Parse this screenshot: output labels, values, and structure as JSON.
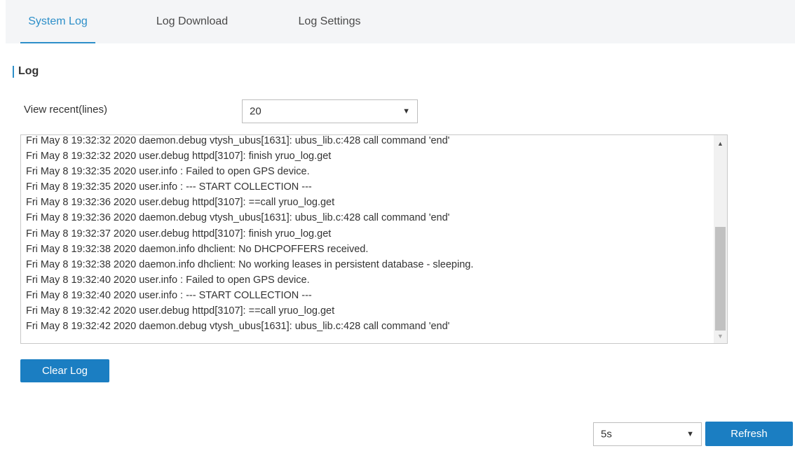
{
  "tabs": [
    {
      "label": "System Log",
      "active": true
    },
    {
      "label": "Log Download",
      "active": false
    },
    {
      "label": "Log Settings",
      "active": false
    }
  ],
  "section": {
    "title": "Log"
  },
  "view_recent": {
    "label": "View recent(lines)",
    "value": "20"
  },
  "log": {
    "lines": [
      "Fri May 8 19:32:32 2020 daemon.debug vtysh_ubus[1631]: ubus_lib.c:428 call command 'end'",
      "Fri May 8 19:32:32 2020 user.debug httpd[3107]: finish yruo_log.get",
      "Fri May 8 19:32:35 2020 user.info : Failed to open GPS device.",
      "Fri May 8 19:32:35 2020 user.info : --- START COLLECTION ---",
      "Fri May 8 19:32:36 2020 user.debug httpd[3107]: ==call yruo_log.get",
      "Fri May 8 19:32:36 2020 daemon.debug vtysh_ubus[1631]: ubus_lib.c:428 call command 'end'",
      "Fri May 8 19:32:37 2020 user.debug httpd[3107]: finish yruo_log.get",
      "Fri May 8 19:32:38 2020 daemon.info dhclient: No DHCPOFFERS received.",
      "Fri May 8 19:32:38 2020 daemon.info dhclient: No working leases in persistent database - sleeping.",
      "Fri May 8 19:32:40 2020 user.info : Failed to open GPS device.",
      "Fri May 8 19:32:40 2020 user.info : --- START COLLECTION ---",
      "Fri May 8 19:32:42 2020 user.debug httpd[3107]: ==call yruo_log.get",
      "Fri May 8 19:32:42 2020 daemon.debug vtysh_ubus[1631]: ubus_lib.c:428 call command 'end'"
    ]
  },
  "buttons": {
    "clear_log": "Clear Log",
    "refresh": "Refresh"
  },
  "refresh_interval": {
    "value": "5s"
  },
  "icons": {
    "dropdown": "chevron-down-icon",
    "scroll_up": "scroll-up-arrow-icon",
    "scroll_down": "scroll-down-arrow-icon"
  },
  "colors": {
    "accent": "#2d8fc9",
    "button": "#1b7ec2",
    "tabbar_bg": "#f4f5f7"
  }
}
